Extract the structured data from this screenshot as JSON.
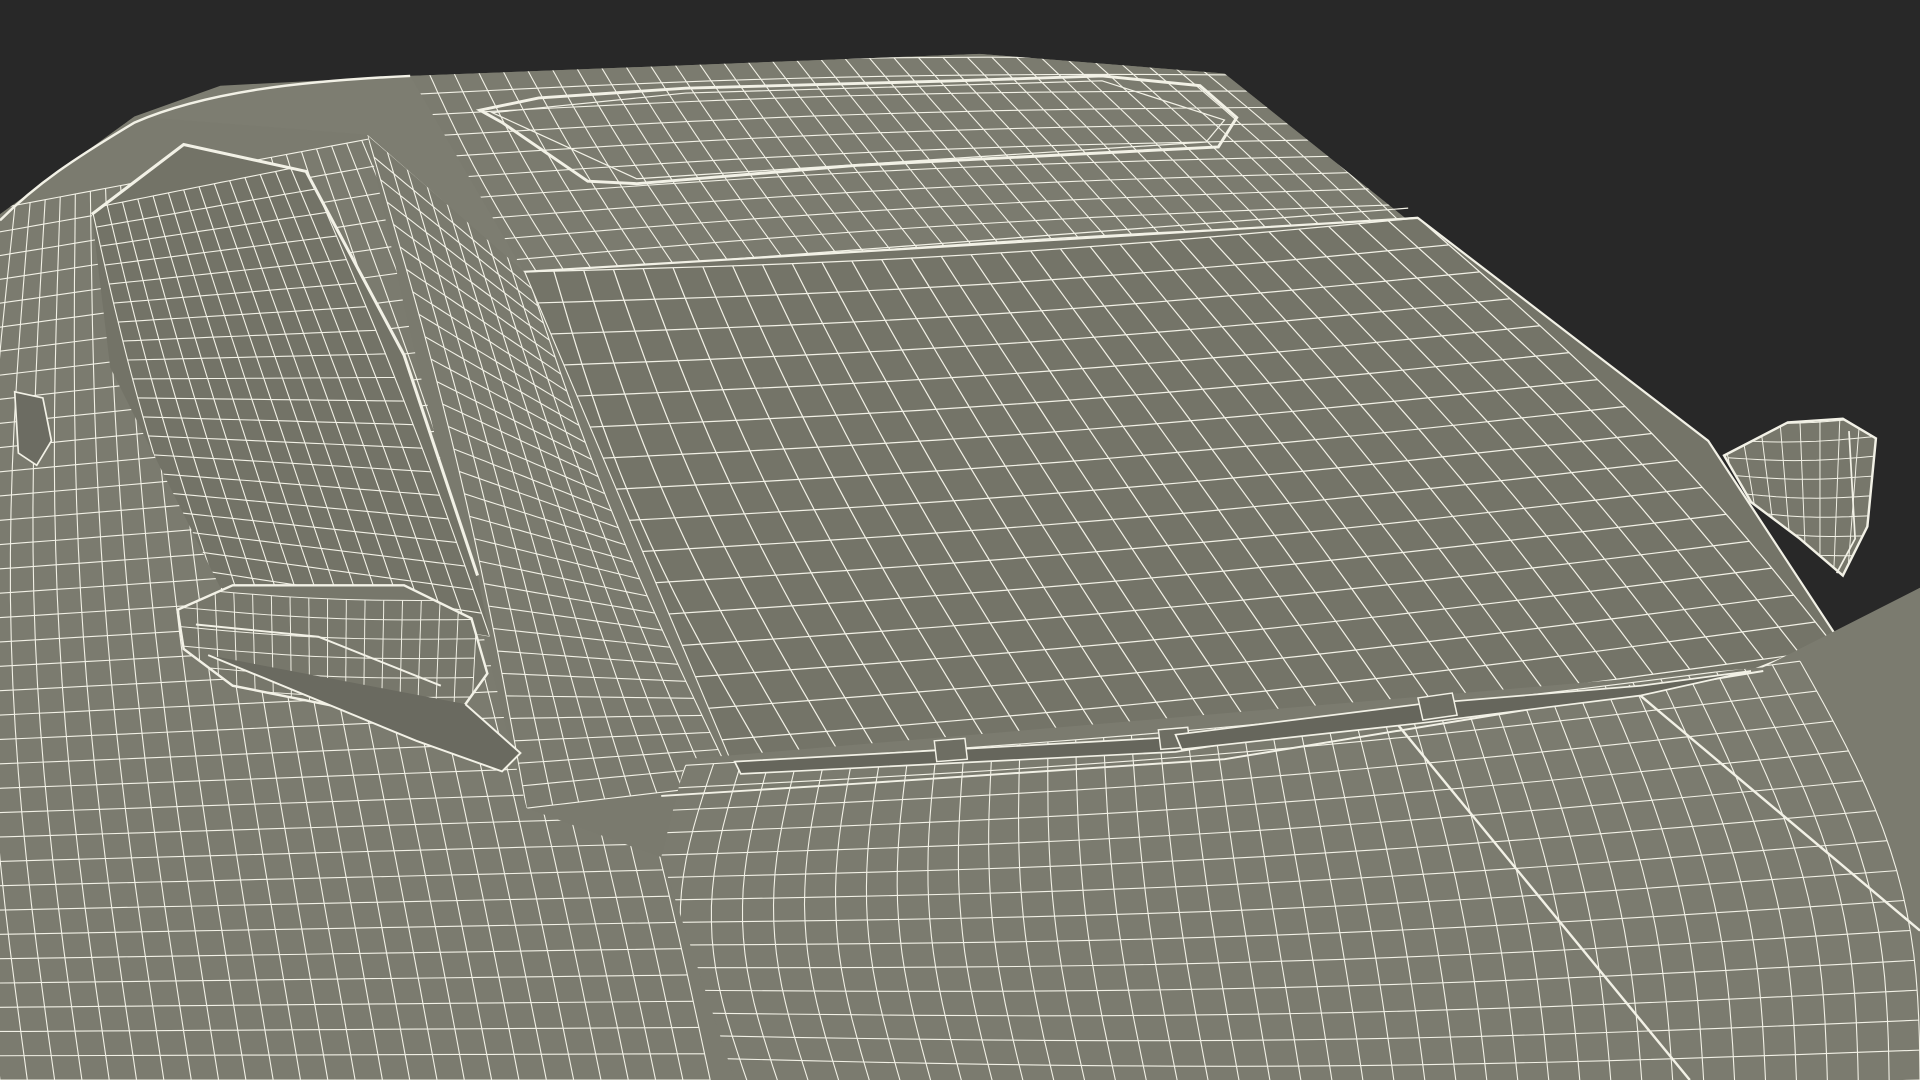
{
  "scene": {
    "subject": "car-wireframe-render",
    "colors": {
      "background": "#282828",
      "surface": "#7d7d71",
      "surface_dark": "#6f6f64",
      "glass": "#747468",
      "wire": "#f2f1e6",
      "wire_faint": "#dcdccf"
    }
  }
}
